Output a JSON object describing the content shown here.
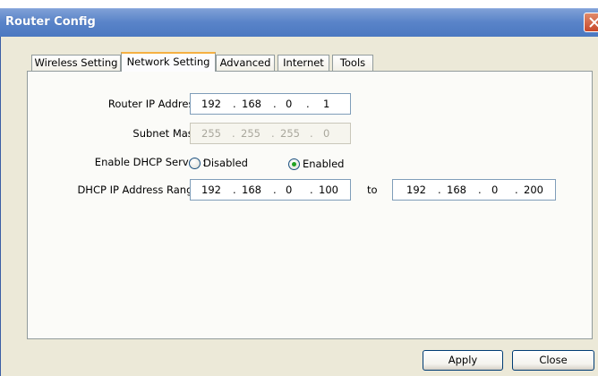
{
  "window": {
    "title": "Router Config"
  },
  "tabs": [
    {
      "label": "Wireless Setting",
      "active": false
    },
    {
      "label": "Network Setting",
      "active": true
    },
    {
      "label": "Advanced",
      "active": false
    },
    {
      "label": "Internet",
      "active": false
    },
    {
      "label": "Tools",
      "active": false
    }
  ],
  "form": {
    "router_ip": {
      "label": "Router IP Address :",
      "octets": [
        "192",
        "168",
        "0",
        "1"
      ],
      "separator": "."
    },
    "subnet_mask": {
      "label": "Subnet Mask :",
      "octets": [
        "255",
        "255",
        "255",
        "0"
      ],
      "separator": ".",
      "disabled": true
    },
    "dhcp": {
      "label": "Enable DHCP Server :",
      "options": [
        {
          "label": "Disabled",
          "selected": false
        },
        {
          "label": "Enabled",
          "selected": true
        }
      ]
    },
    "dhcp_range": {
      "label": "DHCP IP Address Range :",
      "start": [
        "192",
        "168",
        "0",
        "100"
      ],
      "to_label": "to",
      "end": [
        "192",
        "168",
        "0",
        "200"
      ],
      "separator": "."
    }
  },
  "buttons": {
    "apply": "Apply",
    "close": "Close"
  },
  "colors": {
    "titlebar": "#5a84c9",
    "active_tab_accent": "#f5b042",
    "radio_selected": "#21a121"
  }
}
